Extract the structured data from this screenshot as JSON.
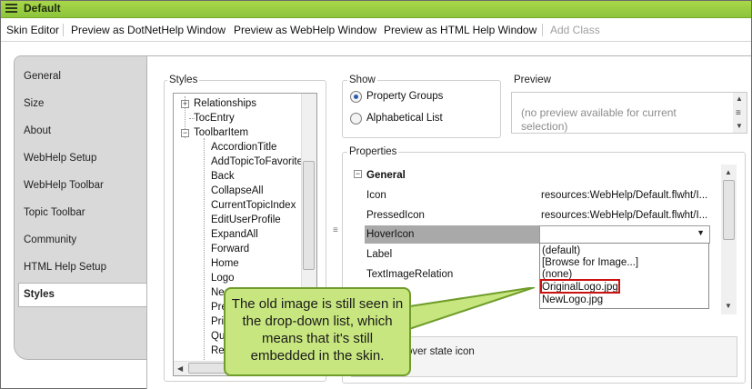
{
  "window": {
    "title": "Default"
  },
  "toolbar": {
    "skin_editor": "Skin Editor",
    "preview_dotnet": "Preview as DotNetHelp Window",
    "preview_webhelp": "Preview as WebHelp Window",
    "preview_htmlhelp": "Preview as HTML Help Window",
    "add_class": "Add Class"
  },
  "sidebar": {
    "items": [
      {
        "label": "General"
      },
      {
        "label": "Size"
      },
      {
        "label": "About"
      },
      {
        "label": "WebHelp Setup"
      },
      {
        "label": "WebHelp Toolbar"
      },
      {
        "label": "Topic Toolbar"
      },
      {
        "label": "Community"
      },
      {
        "label": "HTML Help Setup"
      },
      {
        "label": "Styles"
      }
    ],
    "selected": "Styles"
  },
  "styles_panel": {
    "label": "Styles",
    "tree": [
      "Relationships",
      "TocEntry",
      "ToolbarItem",
      "AccordionTitle",
      "AddTopicToFavorites",
      "Back",
      "CollapseAll",
      "CurrentTopicIndex",
      "EditUserProfile",
      "ExpandAll",
      "Forward",
      "Home",
      "Logo",
      "Ne",
      "Pre",
      "Prir",
      "Qu",
      "Re"
    ]
  },
  "show_panel": {
    "label": "Show",
    "options": [
      "Property Groups",
      "Alphabetical List"
    ],
    "selected": "Property Groups"
  },
  "preview_panel": {
    "label": "Preview",
    "text": "(no preview available for current selection)"
  },
  "properties_panel": {
    "label": "Properties",
    "group": "General",
    "rows": [
      {
        "name": "Icon",
        "value": "resources:WebHelp/Default.flwht/I..."
      },
      {
        "name": "PressedIcon",
        "value": "resources:WebHelp/Default.flwht/I..."
      },
      {
        "name": "HoverIcon",
        "value": ""
      },
      {
        "name": "Label",
        "value": ""
      },
      {
        "name": "TextImageRelation",
        "value": ""
      }
    ],
    "dropdown_options": [
      "(default)",
      "[Browse for Image...]",
      "(none)",
      "OriginalLogo.jpg",
      "NewLogo.jpg"
    ],
    "description": "over state icon"
  },
  "callout": {
    "text": "The old image is still seen in the drop-down list, which means that it's still embedded in the skin."
  }
}
